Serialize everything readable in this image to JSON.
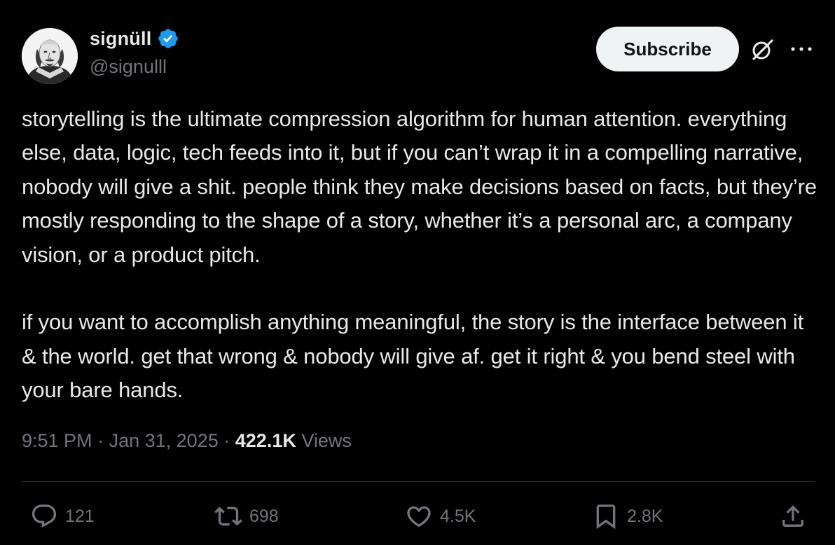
{
  "author": {
    "display_name": "signüll",
    "handle": "@signulll",
    "verified_color": "#1d9bf0"
  },
  "header": {
    "subscribe_label": "Subscribe",
    "grok_icon": "grok-icon",
    "more_icon": "more-icon"
  },
  "tweet": {
    "paragraphs": [
      "storytelling is the ultimate compression algorithm for human attention. everything else, data, logic, tech feeds into it, but if you can’t wrap it in a compelling narrative, nobody will give a shit. people think they make decisions based on facts, but they’re mostly responding to the shape of a story, whether it’s a personal arc, a company vision, or a product pitch.",
      "if you want to accomplish anything meaningful, the story is the interface between it & the world. get that wrong & nobody will give af. get it right & you bend steel with your bare hands."
    ]
  },
  "meta": {
    "time": "9:51 PM",
    "separator": "·",
    "date": "Jan 31, 2025",
    "views_count": "422.1K",
    "views_label": "Views"
  },
  "actions": {
    "replies": "121",
    "reposts": "698",
    "likes": "4.5K",
    "bookmarks": "2.8K"
  },
  "colors": {
    "background": "#000000",
    "text": "#e7e9ea",
    "secondary": "#71767b",
    "divider": "#2f3336",
    "button_bg": "#eff3f4"
  }
}
